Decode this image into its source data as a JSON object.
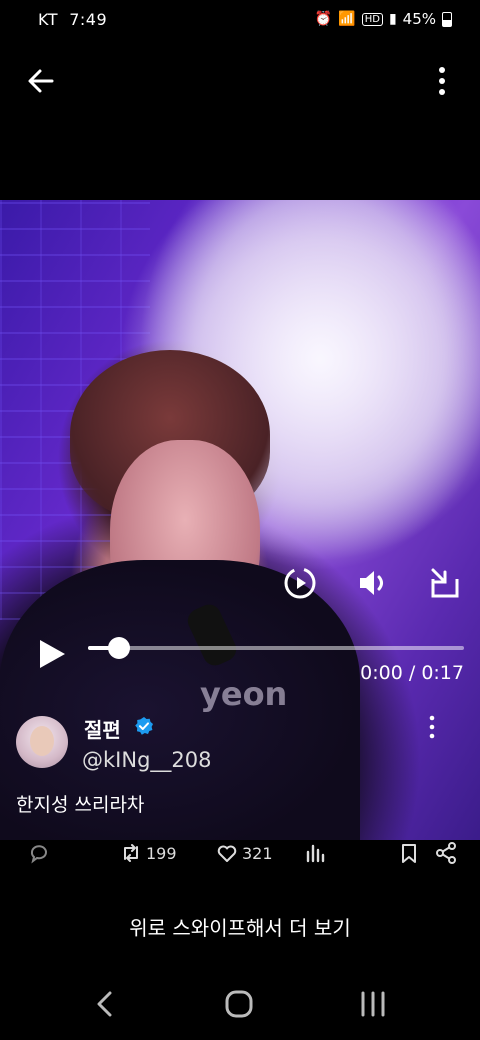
{
  "status_bar": {
    "carrier": "KT",
    "time": "7:49",
    "hd_badge": "HD",
    "battery": "45%"
  },
  "video": {
    "watermark_text": "yeon",
    "time_display": "0:00 / 0:17",
    "progress": 0.0
  },
  "author": {
    "display_name": "절편",
    "handle": "@kINg__208",
    "verified": true
  },
  "tweet": {
    "text": "한지성 쓰리라차"
  },
  "actions": {
    "retweets": "199",
    "likes": "321"
  },
  "swipe_hint": "위로 스와이프해서 더 보기",
  "colors": {
    "verified": "#1d9bf0",
    "background": "#000000"
  },
  "icons": [
    "back-arrow-icon",
    "more-vertical-icon",
    "replay-icon",
    "volume-icon",
    "popout-icon",
    "play-icon",
    "verified-badge-icon",
    "reply-icon",
    "retweet-icon",
    "like-icon",
    "views-icon",
    "bookmark-icon",
    "share-icon",
    "nav-back-icon",
    "nav-home-icon",
    "nav-recents-icon"
  ]
}
